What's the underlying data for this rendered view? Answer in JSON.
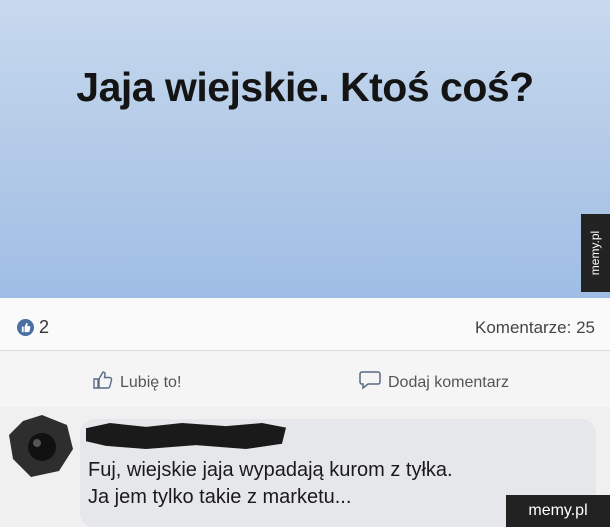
{
  "post": {
    "text": "Jaja wiejskie. Ktoś coś?"
  },
  "stats": {
    "likes": "2",
    "comments_label": "Komentarze: 25"
  },
  "actions": {
    "like_label": "Lubię to!",
    "comment_label": "Dodaj komentarz"
  },
  "comment": {
    "line1": "Fuj, wiejskie jaja wypadają kurom z tyłka.",
    "line2": "Ja jem tylko takie z marketu..."
  },
  "watermark": {
    "side": "memy.pl",
    "bottom": "memy.pl"
  },
  "colors": {
    "banner_top": "#c7d9ee",
    "banner_bottom": "#9fbde5",
    "like_bubble": "#4b6fa0"
  },
  "icons": {
    "like_count": "like-bubble-icon",
    "like_action": "thumbs-up-icon",
    "comment_action": "speech-bubble-icon"
  }
}
